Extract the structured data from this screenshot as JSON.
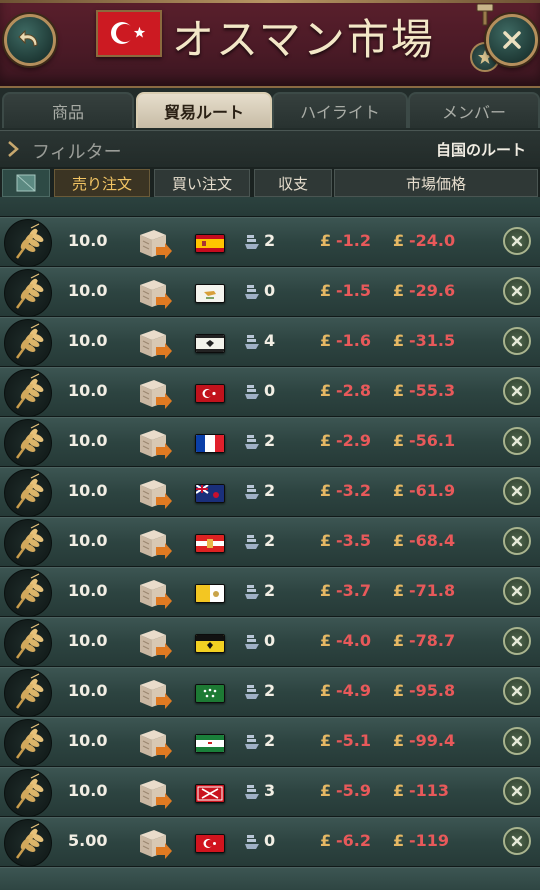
{
  "header": {
    "title": "オスマン市場",
    "colors": {
      "accent": "#b48f5c",
      "banner": "#4a1a26"
    }
  },
  "tabs": [
    {
      "label": "商品",
      "active": false
    },
    {
      "label": "貿易ルート",
      "active": true
    },
    {
      "label": "ハイライト",
      "active": false
    },
    {
      "label": "メンバー",
      "active": false
    }
  ],
  "filter": {
    "label": "フィルター",
    "scope": "自国のルート"
  },
  "sort_columns": [
    {
      "label": "売り注文",
      "active": true
    },
    {
      "label": "買い注文",
      "active": false
    },
    {
      "label": "収支",
      "active": false
    },
    {
      "label": "市場価格",
      "active": false
    }
  ],
  "currency_symbol": "£",
  "routes": [
    {
      "qty": "10.0",
      "flag": "spain",
      "ships": "2",
      "price": "-1.2",
      "total": "-24.0"
    },
    {
      "qty": "10.0",
      "flag": "cyprus-white",
      "ships": "0",
      "price": "-1.5",
      "total": "-29.6"
    },
    {
      "qty": "10.0",
      "flag": "eagle-white",
      "ships": "4",
      "price": "-1.6",
      "total": "-31.5"
    },
    {
      "qty": "10.0",
      "flag": "ottoman-red",
      "ships": "0",
      "price": "-2.8",
      "total": "-55.3"
    },
    {
      "qty": "10.0",
      "flag": "france",
      "ships": "2",
      "price": "-2.9",
      "total": "-56.1"
    },
    {
      "qty": "10.0",
      "flag": "blue-ensign",
      "ships": "2",
      "price": "-3.2",
      "total": "-61.9"
    },
    {
      "qty": "10.0",
      "flag": "red-white-crest",
      "ships": "2",
      "price": "-3.5",
      "total": "-68.4"
    },
    {
      "qty": "10.0",
      "flag": "papal",
      "ships": "2",
      "price": "-3.7",
      "total": "-71.8"
    },
    {
      "qty": "10.0",
      "flag": "black-yellow-eagle",
      "ships": "0",
      "price": "-4.0",
      "total": "-78.7"
    },
    {
      "qty": "10.0",
      "flag": "green-stars",
      "ships": "2",
      "price": "-4.9",
      "total": "-95.8"
    },
    {
      "qty": "10.0",
      "flag": "green-white",
      "ships": "2",
      "price": "-5.1",
      "total": "-99.4"
    },
    {
      "qty": "10.0",
      "flag": "red-swords",
      "ships": "3",
      "price": "-5.9",
      "total": "-113"
    },
    {
      "qty": "5.00",
      "flag": "red-crescent",
      "ships": "0",
      "price": "-6.2",
      "total": "-119"
    }
  ]
}
